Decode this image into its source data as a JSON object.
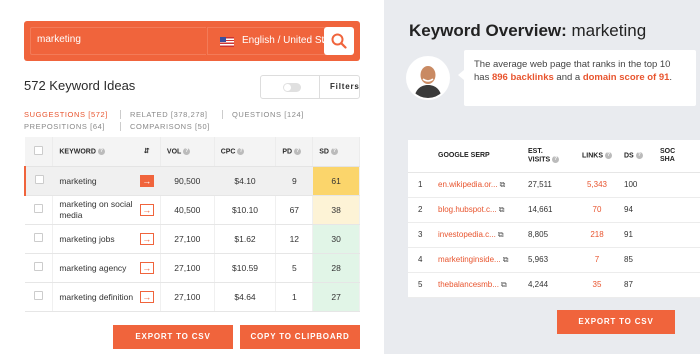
{
  "search": {
    "query": "marketing",
    "language": "English / United St..."
  },
  "ideas": {
    "title": "572 Keyword Ideas",
    "filters_label": "Filters"
  },
  "tabs": [
    {
      "label": "SUGGESTIONS [572]"
    },
    {
      "label": "RELATED [378,278]"
    },
    {
      "label": "QUESTIONS [124]"
    },
    {
      "label": "PREPOSITIONS [64]"
    },
    {
      "label": "COMPARISONS [50]"
    }
  ],
  "kw_table": {
    "headers": {
      "keyword": "KEYWORD",
      "vol": "VOL",
      "cpc": "CPC",
      "pd": "PD",
      "sd": "SD"
    },
    "rows": [
      {
        "keyword": "marketing",
        "vol": "90,500",
        "cpc": "$4.10",
        "pd": "9",
        "sd": "61",
        "sd_color": "#fbd56b"
      },
      {
        "keyword": "marketing on social media",
        "vol": "40,500",
        "cpc": "$10.10",
        "pd": "67",
        "sd": "38",
        "sd_color": "#fdf3d6"
      },
      {
        "keyword": "marketing jobs",
        "vol": "27,100",
        "cpc": "$1.62",
        "pd": "12",
        "sd": "30",
        "sd_color": "#e1f5e7"
      },
      {
        "keyword": "marketing agency",
        "vol": "27,100",
        "cpc": "$10.59",
        "pd": "5",
        "sd": "28",
        "sd_color": "#e1f5e7"
      },
      {
        "keyword": "marketing definition",
        "vol": "27,100",
        "cpc": "$4.64",
        "pd": "1",
        "sd": "27",
        "sd_color": "#e1f5e7"
      }
    ]
  },
  "buttons": {
    "export_csv": "EXPORT TO CSV",
    "copy_clipboard": "COPY TO CLIPBOARD",
    "export_csv_right": "EXPORT TO CSV"
  },
  "overview": {
    "title_bold": "Keyword Overview:",
    "title_keyword": "marketing",
    "msg_part1": "The average web page that ranks in the top 10 has ",
    "msg_backlinks": "896 backlinks",
    "msg_part2": " and a ",
    "msg_domain": "domain score of 91",
    "msg_part3": "."
  },
  "serp_table": {
    "headers": {
      "serp": "GOOGLE SERP",
      "visits_1": "EST.",
      "visits_2": "VISITS",
      "links": "LINKS",
      "ds": "DS",
      "social_1": "SOC",
      "social_2": "SHA"
    },
    "rows": [
      {
        "rank": "1",
        "url": "en.wikipedia.or...",
        "visits": "27,511",
        "links": "5,343",
        "ds": "100"
      },
      {
        "rank": "2",
        "url": "blog.hubspot.c...",
        "visits": "14,661",
        "links": "70",
        "ds": "94"
      },
      {
        "rank": "3",
        "url": "investopedia.c...",
        "visits": "8,805",
        "links": "218",
        "ds": "91"
      },
      {
        "rank": "4",
        "url": "marketinginside...",
        "visits": "5,963",
        "links": "7",
        "ds": "85"
      },
      {
        "rank": "5",
        "url": "thebalancesmb...",
        "visits": "4,244",
        "links": "35",
        "ds": "87"
      }
    ]
  },
  "colors": {
    "accent": "#f0643c",
    "panel_bg": "#e9ebef"
  }
}
